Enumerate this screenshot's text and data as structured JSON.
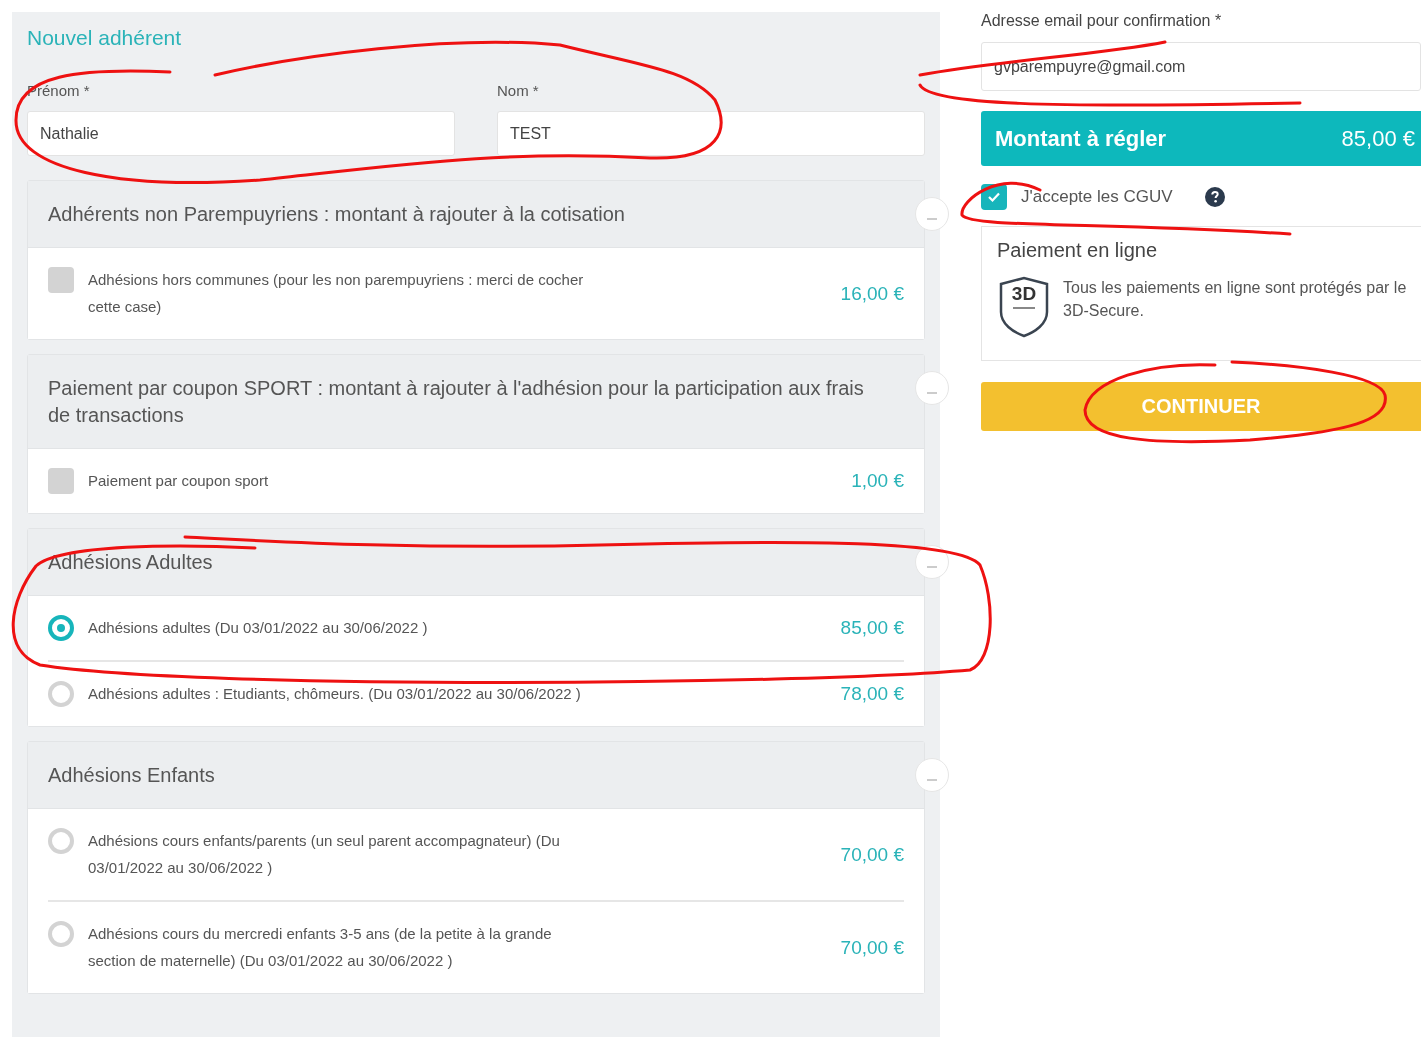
{
  "form": {
    "title": "Nouvel adhérent",
    "fields": [
      {
        "label": "Prénom *",
        "value": "Nathalie"
      },
      {
        "label": "Nom *",
        "value": "TEST"
      }
    ]
  },
  "sections": [
    {
      "title": "Adhérents non Parempuyriens : montant à rajouter à la cotisation",
      "expanded": true,
      "items": [
        {
          "kind": "checkbox",
          "label": "Adhésions hors communes (pour les non parempuyriens : merci de cocher cette case)",
          "price": "16,00 €",
          "checked": false
        }
      ]
    },
    {
      "title": "Paiement par coupon SPORT : montant à rajouter à l'adhésion pour la participation aux frais de transactions",
      "expanded": true,
      "items": [
        {
          "kind": "checkbox",
          "label": "Paiement par coupon sport",
          "price": "1,00 €",
          "checked": false
        }
      ]
    },
    {
      "title": "Adhésions Adultes",
      "expanded": true,
      "items": [
        {
          "kind": "radio",
          "label": "Adhésions adultes (Du 03/01/2022 au 30/06/2022 )",
          "price": "85,00 €",
          "selected": true
        },
        {
          "kind": "radio",
          "label": "Adhésions adultes : Etudiants, chômeurs. (Du 03/01/2022 au 30/06/2022 )",
          "price": "78,00 €",
          "selected": false
        }
      ]
    },
    {
      "title": "Adhésions Enfants",
      "expanded": true,
      "items": [
        {
          "kind": "radio",
          "label": "Adhésions cours enfants/parents (un seul parent accompagnateur) (Du 03/01/2022 au 30/06/2022 )",
          "price": "70,00 €",
          "selected": false
        },
        {
          "kind": "radio",
          "label": "Adhésions cours du mercredi enfants 3-5 ans (de la petite à la grande section de maternelle) (Du 03/01/2022 au 30/06/2022 )",
          "price": "70,00 €",
          "selected": false
        }
      ]
    }
  ],
  "email": {
    "label": "Adresse email pour confirmation *",
    "value": "gvparempuyre@gmail.com"
  },
  "total": {
    "label": "Montant à régler",
    "amount": "85,00 €"
  },
  "terms": {
    "label": "J'accepte les CGUV",
    "checked": true
  },
  "payment": {
    "title": "Paiement en ligne",
    "badge": "3D",
    "note": "Tous les paiements en ligne sont protégés par le 3D-Secure."
  },
  "continue_button": "CONTINUER"
}
